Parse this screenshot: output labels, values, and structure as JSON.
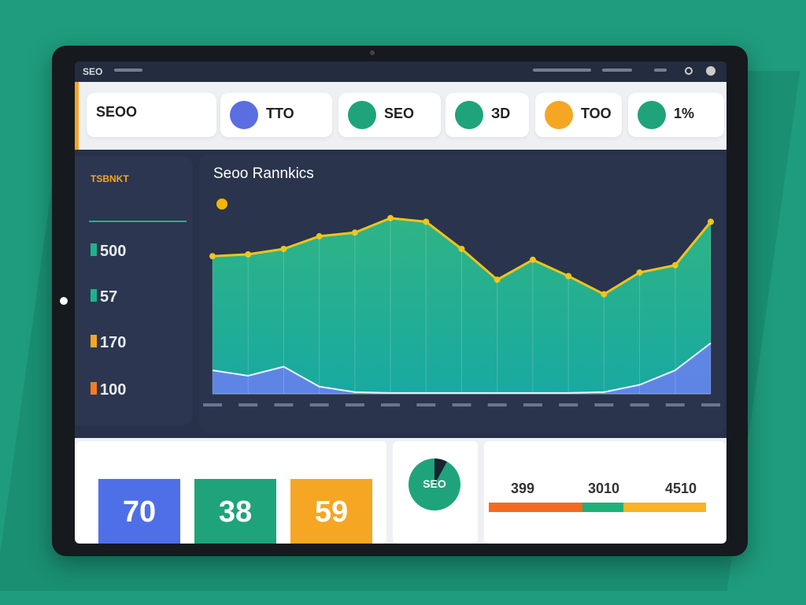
{
  "nav": {
    "logo": "SEO"
  },
  "cards": [
    {
      "value": "SEOO",
      "color": "#ffffff"
    },
    {
      "value": "TTO",
      "color": "#5b6ee1"
    },
    {
      "value": "SEO",
      "color": "#1fa37a"
    },
    {
      "value": "ЗD",
      "color": "#1fa37a"
    },
    {
      "value": "TOO",
      "color": "#f5a623"
    },
    {
      "value": "1%",
      "color": "#1fa37a"
    }
  ],
  "sidebar": {
    "title": "TSBNKT",
    "progress": 1.0,
    "stats": [
      {
        "value": "500",
        "color": "#1fb38a"
      },
      {
        "value": "57",
        "color": "#1fb38a"
      },
      {
        "value": "170",
        "color": "#f5a623"
      },
      {
        "value": "100",
        "color": "#f57c23"
      }
    ]
  },
  "chart_data": {
    "type": "area",
    "title": "Seoo Rannkics",
    "grid": true,
    "ylim": [
      0,
      100
    ],
    "x": [
      0,
      1,
      2,
      3,
      4,
      5,
      6,
      7,
      8,
      9,
      10,
      11,
      12,
      13,
      14
    ],
    "series": [
      {
        "color": "#f0c419",
        "values": [
          76,
          77,
          80,
          87,
          89,
          97,
          95,
          80,
          63,
          74,
          65,
          55,
          67,
          71,
          95
        ]
      },
      {
        "color": "#6b7ff0",
        "values": [
          13,
          10,
          15,
          4,
          1,
          0.5,
          0.5,
          0.5,
          0.5,
          0.5,
          0.5,
          1,
          5,
          13,
          28
        ]
      }
    ]
  },
  "bottom": {
    "tiles": [
      {
        "value": "70",
        "color": "#4f6fe8"
      },
      {
        "value": "38",
        "color": "#1fa37a"
      },
      {
        "value": "59",
        "color": "#f5a623"
      }
    ],
    "pie_label": "SEO",
    "numbers": [
      "399",
      "3010",
      "4510"
    ],
    "bar_segments": [
      {
        "color": "#f26b21",
        "share": 0.43
      },
      {
        "color": "#1fb07a",
        "share": 0.19
      },
      {
        "color": "#f7b324",
        "share": 0.38
      }
    ]
  }
}
